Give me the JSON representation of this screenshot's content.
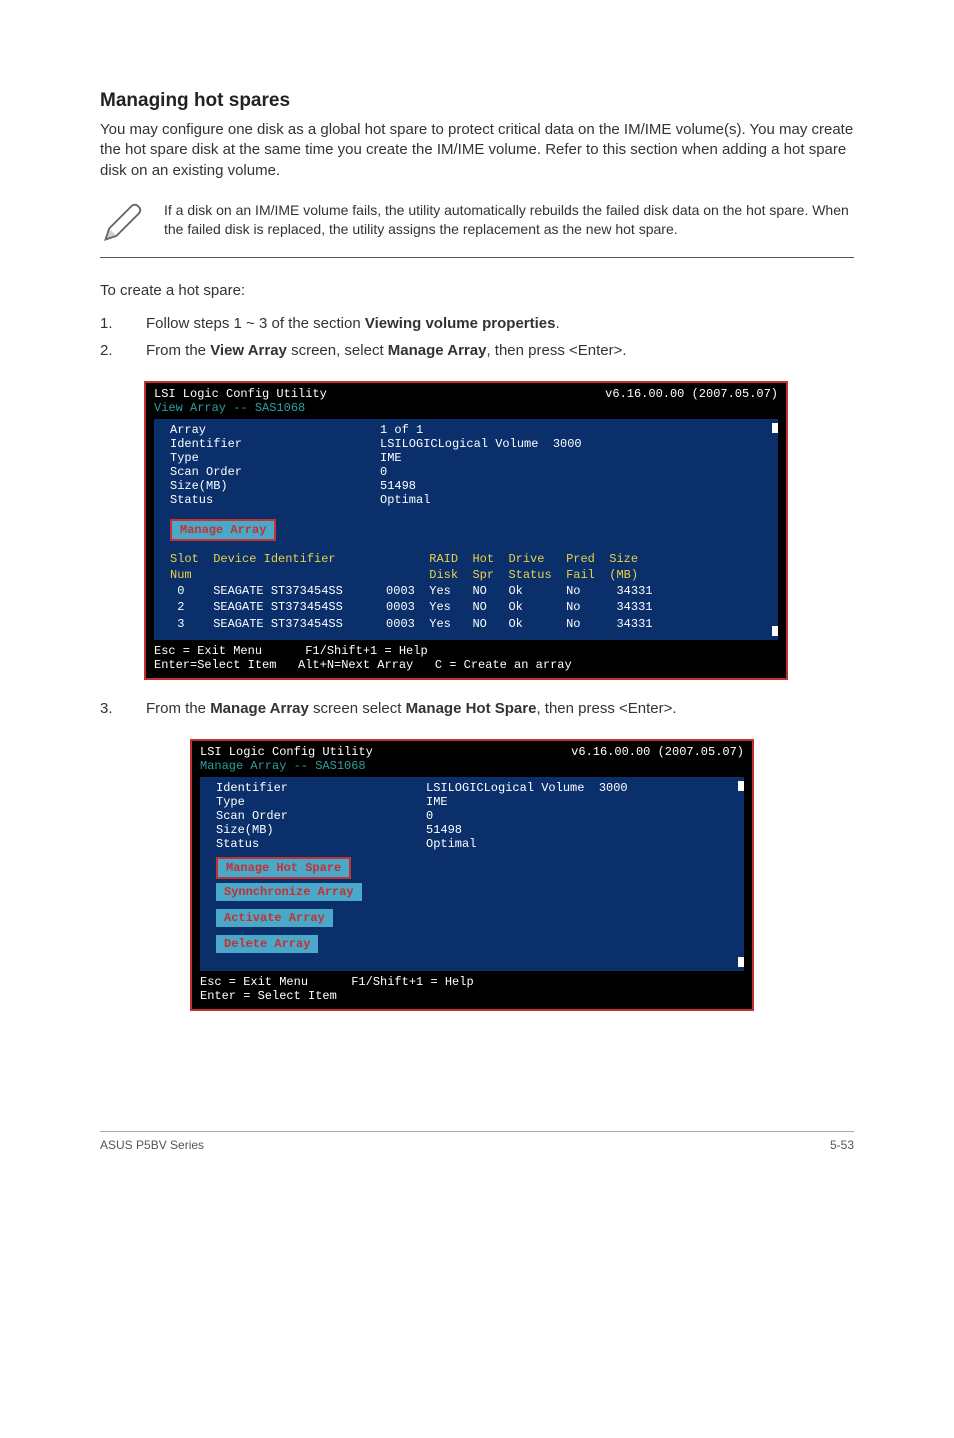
{
  "heading": "Managing hot spares",
  "intro": "You may configure one disk as a global hot spare to protect critical data on the IM/IME volume(s). You may create the hot spare disk at the same time you create the IM/IME volume. Refer to this section when adding a hot spare disk on an existing volume.",
  "note": "If a disk on an IM/IME volume fails, the utility automatically rebuilds the failed disk data on the hot spare. When the failed disk is replaced, the utility assigns the replacement as the new hot spare.",
  "lead": "To create a hot spare:",
  "steps": {
    "1": {
      "pre": "Follow steps 1 ~ 3 of the section ",
      "bold": "Viewing volume properties",
      "post": "."
    },
    "2": {
      "pre": "From the ",
      "b1": "View Array",
      "mid": " screen, select ",
      "b2": "Manage Array",
      "post": ", then press <Enter>."
    },
    "3": {
      "pre": "From the ",
      "b1": "Manage Array",
      "mid": " screen select ",
      "b2": "Manage Hot Spare",
      "post": ", then press <Enter>."
    }
  },
  "bios1": {
    "title_left": "LSI Logic Config Utility",
    "title_right": "v6.16.00.00 (2007.05.07)",
    "subtitle": "View Array -- SAS1068",
    "props": {
      "Array": "1 of 1",
      "Identifier": "LSILOGICLogical Volume  3000",
      "Type": "IME",
      "Scan Order": "0",
      "Size(MB)": "51498",
      "Status": "Optimal"
    },
    "manage_label": "Manage Array",
    "table": {
      "headers": [
        "Slot",
        "Device Identifier",
        "",
        "RAID",
        "Hot",
        "Drive",
        "Pred",
        "Size"
      ],
      "headers2": [
        "Num",
        "",
        "",
        "Disk",
        "Spr",
        "Status",
        "Fail",
        "(MB)"
      ],
      "rows": [
        {
          "slot": "0",
          "dev": "SEAGATE ST373454SS",
          "code": "0003",
          "raid": "Yes",
          "hot": "NO",
          "drive": "Ok",
          "pred": "No",
          "size": "34331"
        },
        {
          "slot": "2",
          "dev": "SEAGATE ST373454SS",
          "code": "0003",
          "raid": "Yes",
          "hot": "NO",
          "drive": "Ok",
          "pred": "No",
          "size": "34331"
        },
        {
          "slot": "3",
          "dev": "SEAGATE ST373454SS",
          "code": "0003",
          "raid": "Yes",
          "hot": "NO",
          "drive": "Ok",
          "pred": "No",
          "size": "34331"
        }
      ]
    },
    "footer1": "Esc = Exit Menu      F1/Shift+1 = Help",
    "footer2": "Enter=Select Item   Alt+N=Next Array   C = Create an array"
  },
  "bios2": {
    "title_left": "LSI Logic Config Utility",
    "title_right": "v6.16.00.00 (2007.05.07)",
    "subtitle": "Manage Array -- SAS1068",
    "props": {
      "Identifier": "LSILOGICLogical Volume  3000",
      "Type": "IME",
      "Scan Order": "0",
      "Size(MB)": "51498",
      "Status": "Optimal"
    },
    "actions": [
      "Manage Hot Spare",
      "Synnchronize Array",
      "Activate Array",
      "Delete Array"
    ],
    "footer1": "Esc = Exit Menu      F1/Shift+1 = Help",
    "footer2": "Enter = Select Item"
  },
  "footer": {
    "left": "ASUS P5BV Series",
    "right": "5-53"
  }
}
